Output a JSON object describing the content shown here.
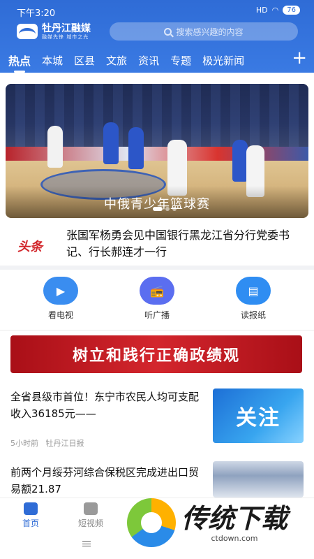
{
  "status_bar": {
    "time": "下午3:20",
    "signal": "HD",
    "battery": "76"
  },
  "header": {
    "logo_name": "牡丹江融媒",
    "logo_slogan": "融媒先锋  城市之光",
    "search_placeholder": "搜索感兴趣的内容"
  },
  "tabs": [
    "热点",
    "本城",
    "区县",
    "文旅",
    "资讯",
    "专题",
    "极光新闻"
  ],
  "active_tab_index": 0,
  "banner": {
    "caption": "中俄青少年篮球赛",
    "slide_count": 3,
    "active_slide": 0
  },
  "headline": {
    "tag": "头条",
    "text": "张国军杨勇会见中国银行黑龙江省分行党委书记、行长郝连才一行"
  },
  "quick_links": [
    {
      "label": "看电视",
      "icon": "tv-film-icon",
      "color": "#3a8df0"
    },
    {
      "label": "听广播",
      "icon": "radio-icon",
      "color": "#5b6ef0"
    },
    {
      "label": "读报纸",
      "icon": "newspaper-icon",
      "color": "#2f8df2"
    }
  ],
  "promo_banner": {
    "text": "树立和践行正确政绩观"
  },
  "news": [
    {
      "title": "全省县级市首位！东宁市农民人均可支配收入36185元——",
      "time": "5小时前",
      "source": "牡丹江日报",
      "thumb_text": "关注"
    },
    {
      "title": "前两个月绥芬河综合保税区完成进出口贸易额21.87",
      "time": "",
      "source": "",
      "thumb_text": ""
    }
  ],
  "bottom_nav": [
    {
      "label": "首页",
      "active": true
    },
    {
      "label": "短视频",
      "active": false
    }
  ],
  "watermark": {
    "name": "传统下载",
    "url": "ctdown.com"
  },
  "colors": {
    "brand_blue": "#2f6cd6",
    "headline_red": "#d2262b",
    "promo_red": "#c31b22"
  }
}
